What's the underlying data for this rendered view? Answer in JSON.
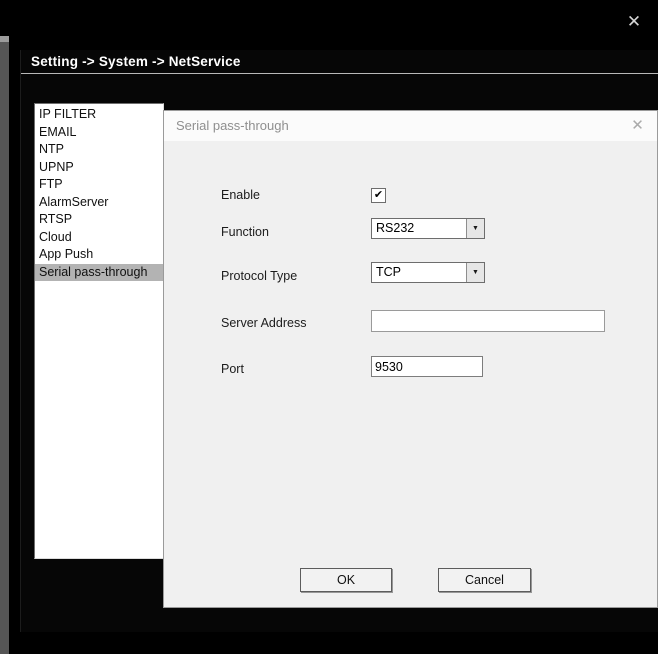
{
  "screen": {
    "close_icon": "✕"
  },
  "window": {
    "title": "Setting -> System -> NetService"
  },
  "sidebar": {
    "items": [
      "IP FILTER",
      "EMAIL",
      "NTP",
      "UPNP",
      "FTP",
      "AlarmServer",
      "RTSP",
      "Cloud",
      "App Push",
      "Serial pass-through"
    ],
    "selected_index": 9
  },
  "dialog": {
    "title": "Serial pass-through",
    "close_icon": "✕",
    "enable_label": "Enable",
    "enable_checked": true,
    "function_label": "Function",
    "function_value": "RS232",
    "protocol_label": "Protocol Type",
    "protocol_value": "TCP",
    "server_label": "Server Address",
    "server_value": "",
    "port_label": "Port",
    "port_value": "9530",
    "ok_label": "OK",
    "cancel_label": "Cancel"
  },
  "icons": {
    "check": "✔",
    "dropdown_arrow": "▼"
  }
}
